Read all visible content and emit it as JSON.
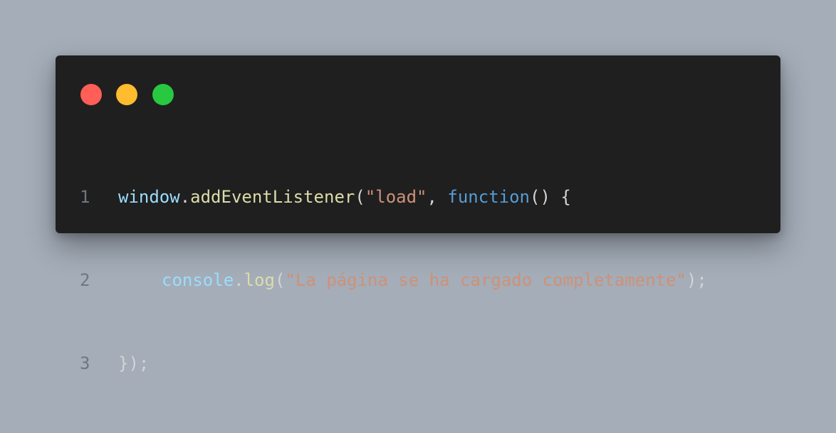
{
  "window": {
    "buttons": [
      {
        "name": "close",
        "color": "#ff5f57"
      },
      {
        "name": "minimize",
        "color": "#febc2e"
      },
      {
        "name": "maximize",
        "color": "#28c840"
      }
    ]
  },
  "code": {
    "language": "javascript",
    "lines": [
      {
        "number": "1",
        "tokens": {
          "t1": "window",
          "t2": ".",
          "t3": "addEventListener",
          "t4": "(",
          "t5": "\"load\"",
          "t6": ", ",
          "t7": "function",
          "t8": "() {"
        }
      },
      {
        "number": "2",
        "tokens": {
          "t1": "console",
          "t2": ".",
          "t3": "log",
          "t4": "(",
          "t5": "\"La página se ha cargado completamente\"",
          "t6": ");"
        }
      },
      {
        "number": "3",
        "tokens": {
          "t1": "});"
        }
      }
    ]
  }
}
